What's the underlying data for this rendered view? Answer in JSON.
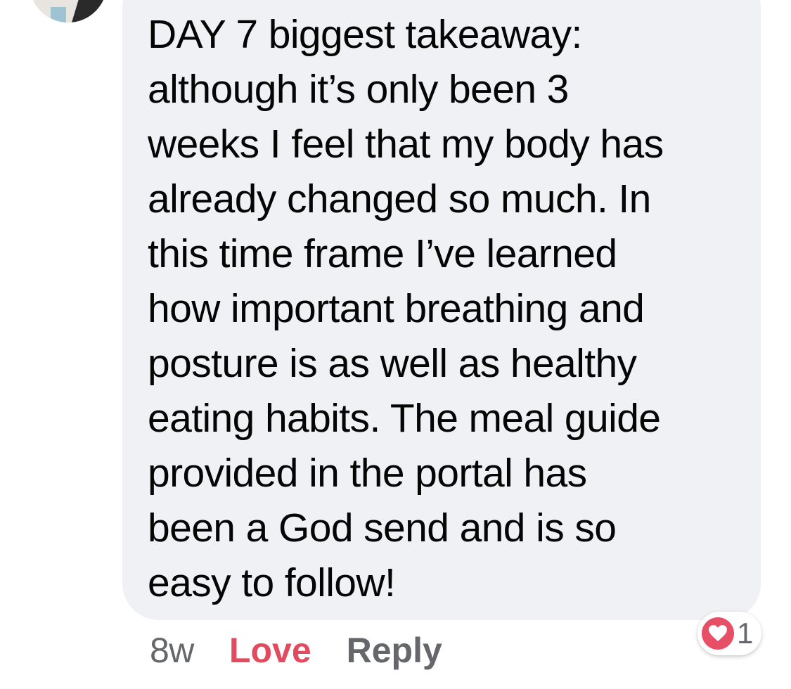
{
  "comment": {
    "text": "DAY 7 biggest takeaway:\nalthough it’s only been 3\nweeks I feel that my body has\nalready changed so much. In\nthis time frame I’ve learned\nhow important breathing and\nposture is as well as healthy\neating habits. The meal guide\nprovided in the portal has\nbeen a God send and is so\neasy to follow!",
    "timestamp": "8w",
    "love_label": "Love",
    "reply_label": "Reply"
  },
  "reactions": {
    "icon": "heart-icon",
    "count": "1"
  },
  "colors": {
    "bubble": "#f0f1f4",
    "love": "#e24a5f",
    "muted": "#65676b",
    "heart": "#e64f66"
  }
}
